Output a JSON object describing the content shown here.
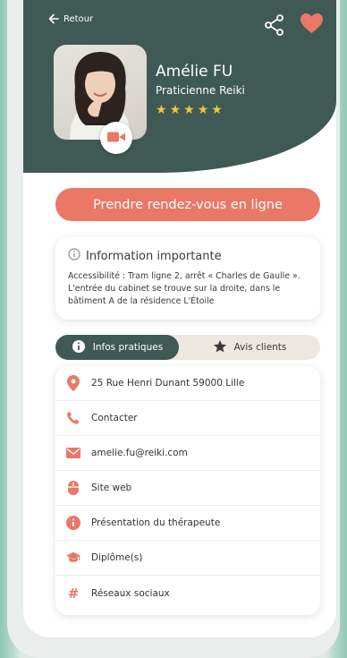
{
  "header": {
    "back_label": "Retour",
    "icons": {
      "back": "arrow-left-icon",
      "share": "share-icon",
      "favorite": "heart-icon"
    }
  },
  "profile": {
    "name": "Amélie FU",
    "role": "Praticienne Reiki",
    "rating": 5,
    "stars": [
      "★",
      "★",
      "★",
      "★",
      "★"
    ],
    "video_icon": "video-camera-icon"
  },
  "cta": {
    "label": "Prendre rendez-vous en ligne"
  },
  "info": {
    "title": "Information importante",
    "text": "Accessibilité : Tram ligne 2, arrêt « Charles de Gaulle ». L'entrée du cabinet se trouve sur la droite, dans le bâtiment A de la résidence L'Étoile"
  },
  "tabs": [
    {
      "label": "Infos pratiques",
      "icon": "info-icon",
      "active": true
    },
    {
      "label": "Avis clients",
      "icon": "star-icon",
      "active": false
    }
  ],
  "rows": [
    {
      "label": "25 Rue Henri Dunant 59000 Lille",
      "icon": "map-pin-icon"
    },
    {
      "label": "Contacter",
      "icon": "phone-icon"
    },
    {
      "label": "amelie.fu@reiki.com",
      "icon": "envelope-icon"
    },
    {
      "label": "Site web",
      "icon": "mouse-icon"
    },
    {
      "label": "Présentation du thérapeute",
      "icon": "info-circle-icon"
    },
    {
      "label": "Diplôme(s)",
      "icon": "graduation-cap-icon"
    },
    {
      "label": "Réseaux sociaux",
      "icon": "hashtag-icon"
    }
  ],
  "colors": {
    "primary_dark": "#3f5a54",
    "accent": "#ea7866",
    "star": "#f4c542",
    "tab_bg": "#ece8e0"
  }
}
